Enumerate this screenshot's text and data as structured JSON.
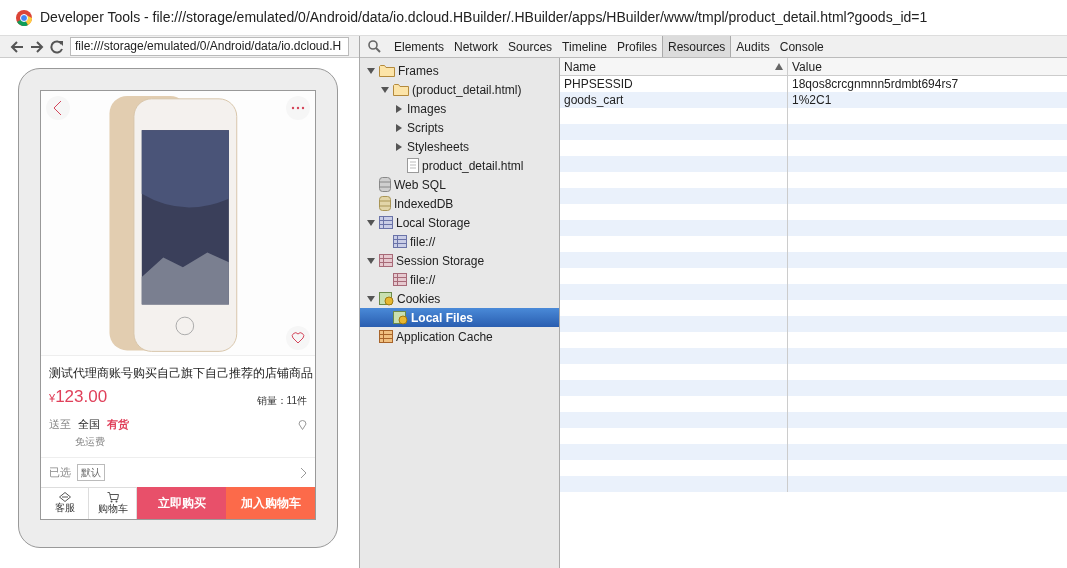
{
  "window": {
    "title": "Developer Tools - file:///storage/emulated/0/Android/data/io.dcloud.HBuilder/.HBuilder/apps/HBuilder/www/tmpl/product_detail.html?goods_id=1"
  },
  "address_bar": {
    "value": "file:///storage/emulated/0/Android/data/io.dcloud.H"
  },
  "tabs": [
    {
      "label": "Elements",
      "selected": false
    },
    {
      "label": "Network",
      "selected": false
    },
    {
      "label": "Sources",
      "selected": false
    },
    {
      "label": "Timeline",
      "selected": false
    },
    {
      "label": "Profiles",
      "selected": false
    },
    {
      "label": "Resources",
      "selected": true
    },
    {
      "label": "Audits",
      "selected": false
    },
    {
      "label": "Console",
      "selected": false
    }
  ],
  "phone": {
    "product": {
      "title": "测试代理商账号购买自己旗下自己推荐的店铺商品",
      "currency": "¥",
      "price": "123.00",
      "sales": "销量：11件",
      "ship_label": "送至",
      "ship_region": "全国",
      "stock": "有货",
      "shipping_fee": "免运费",
      "selected_label": "已选",
      "selected_option": "默认"
    },
    "bottom_bar": [
      {
        "kind": "service",
        "label": "客服"
      },
      {
        "kind": "cart",
        "label": "购物车"
      },
      {
        "kind": "primary",
        "label": "立即购买",
        "color": "#e8506a"
      },
      {
        "kind": "primary",
        "label": "加入购物车",
        "color": "#fc6a4a"
      }
    ]
  },
  "tree": [
    {
      "label": "Frames",
      "kind": "folder",
      "expanded": true,
      "selected": false,
      "children": [
        {
          "label": "(product_detail.html)",
          "kind": "folder",
          "expanded": true,
          "selected": false,
          "children": [
            {
              "label": "Images",
              "kind": "group",
              "expanded": false,
              "selected": false
            },
            {
              "label": "Scripts",
              "kind": "group",
              "expanded": false,
              "selected": false
            },
            {
              "label": "Stylesheets",
              "kind": "group",
              "expanded": false,
              "selected": false
            },
            {
              "label": "product_detail.html",
              "kind": "file",
              "selected": false
            }
          ]
        }
      ]
    },
    {
      "label": "Web SQL",
      "kind": "db",
      "selected": false
    },
    {
      "label": "IndexedDB",
      "kind": "idb",
      "selected": false
    },
    {
      "label": "Local Storage",
      "kind": "local",
      "expanded": true,
      "selected": false,
      "children": [
        {
          "label": "file://",
          "kind": "local",
          "selected": false
        }
      ]
    },
    {
      "label": "Session Storage",
      "kind": "session",
      "expanded": true,
      "selected": false,
      "children": [
        {
          "label": "file://",
          "kind": "session",
          "selected": false
        }
      ]
    },
    {
      "label": "Cookies",
      "kind": "cookie",
      "expanded": true,
      "selected": false,
      "children": [
        {
          "label": "Local Files",
          "kind": "cookie",
          "selected": true
        }
      ]
    },
    {
      "label": "Application Cache",
      "kind": "appcache",
      "selected": false
    }
  ],
  "table": {
    "columns": [
      {
        "label": "Name",
        "sorted": true
      },
      {
        "label": "Value",
        "sorted": false
      }
    ],
    "rows": [
      [
        "PHPSESSID",
        "18qos8crcgnmnn5rdmbt694rs7"
      ],
      [
        "goods_cart",
        "1%2C1"
      ]
    ]
  }
}
